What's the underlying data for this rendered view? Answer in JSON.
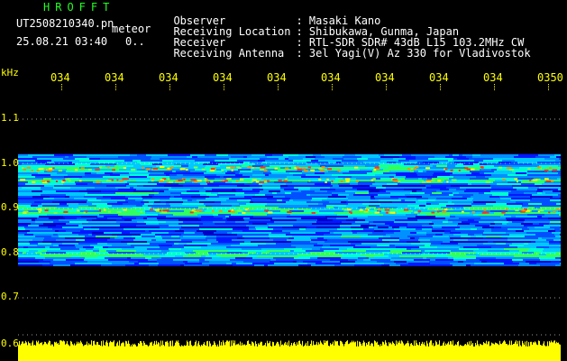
{
  "header": {
    "app_title": "HROFFT",
    "filename": "UT2508210340.pn",
    "file_type": "meteor",
    "datetime": "25.08.21 03:40",
    "count": "0..",
    "meta": [
      {
        "label": "Observer",
        "value": ": Masaki Kano"
      },
      {
        "label": "Receiving Location",
        "value": ": Shibukawa, Gunma, Japan"
      },
      {
        "label": "Receiver",
        "value": ": RTL-SDR SDR# 43dB L15 103.2MHz CW"
      },
      {
        "label": "Receiving Antenna",
        "value": ": 3el Yagi(V) Az 330 for Vladivostok"
      }
    ]
  },
  "axis": {
    "y_unit": "kHz",
    "y_ticks": [
      "1.1",
      "1.0",
      "0.9",
      "0.8",
      "0.7",
      "0.6"
    ],
    "x_ticks": [
      "034",
      "034",
      "034",
      "034",
      "034",
      "034",
      "034",
      "034",
      "034",
      "0350"
    ]
  },
  "colors": {
    "text_header": "#ffffff",
    "title": "#22ff22",
    "axis": "#ffff00",
    "gridline": "#ffffff",
    "noise_bar": "#ffff00",
    "background": "#000000"
  }
}
